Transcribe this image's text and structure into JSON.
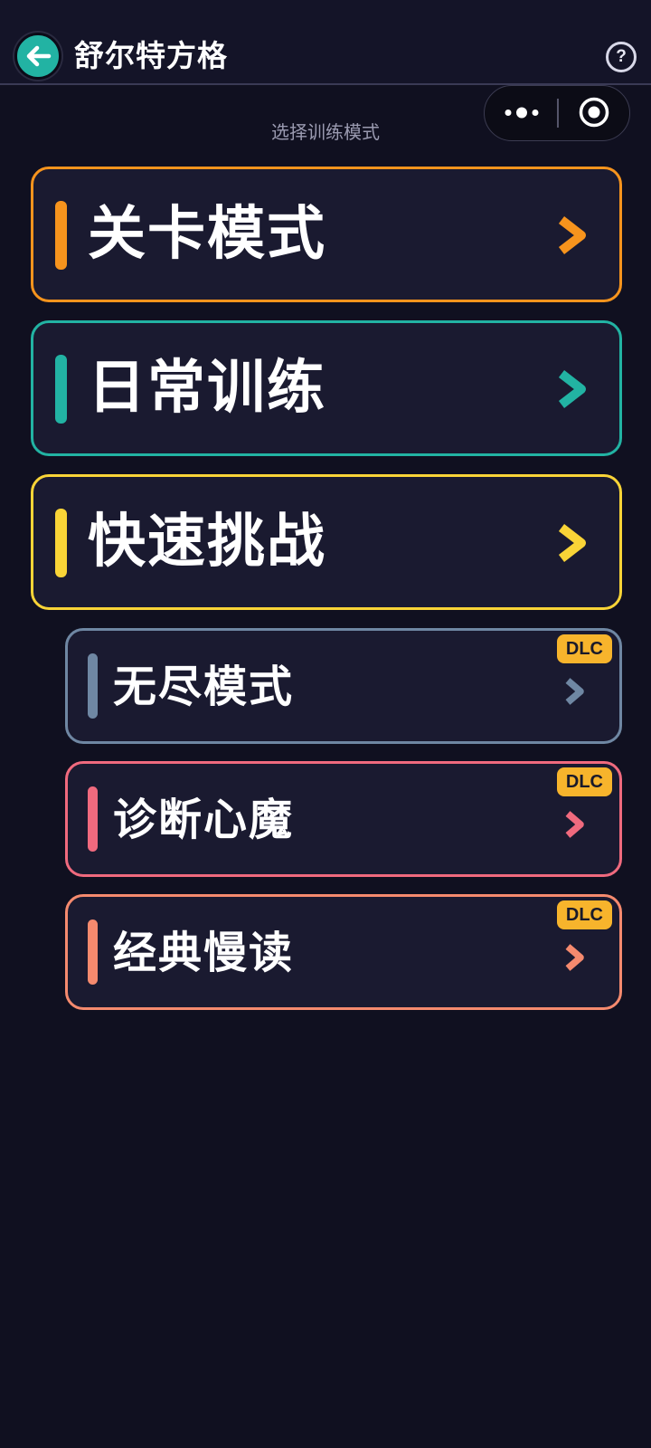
{
  "header": {
    "title": "舒尔特方格",
    "back_icon": "arrow-left-icon",
    "help_label": "?"
  },
  "capsule": {
    "menu_icon": "more-dots-icon",
    "close_icon": "target-circle-icon"
  },
  "subtitle": "选择训练模式",
  "modes": [
    {
      "label": "关卡模式",
      "color": "#f7941d"
    },
    {
      "label": "日常训练",
      "color": "#22b3a3"
    },
    {
      "label": "快速挑战",
      "color": "#f9d437"
    }
  ],
  "dlc_modes": [
    {
      "label": "无尽模式",
      "badge": "DLC",
      "color": "#6f87a3"
    },
    {
      "label": "诊断心魔",
      "badge": "DLC",
      "color": "#f06a7e"
    },
    {
      "label": "经典慢读",
      "badge": "DLC",
      "color": "#f58a6e"
    }
  ],
  "colors": {
    "background": "#101020",
    "card": "#1a1a30",
    "badge": "#f7b42c"
  }
}
